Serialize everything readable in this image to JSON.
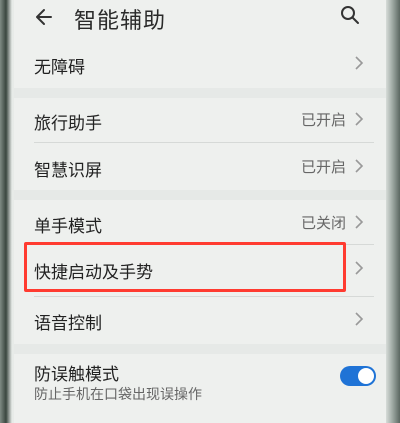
{
  "header": {
    "title": "智能辅助"
  },
  "items": [
    {
      "label": "无障碍",
      "status": ""
    },
    {
      "label": "旅行助手",
      "status": "已开启"
    },
    {
      "label": "智慧识屏",
      "status": "已开启"
    },
    {
      "label": "单手模式",
      "status": "已关闭"
    },
    {
      "label": "快捷启动及手势",
      "status": ""
    },
    {
      "label": "语音控制",
      "status": ""
    }
  ],
  "toggle_item": {
    "label": "防误触模式",
    "sublabel": "防止手机在口袋出现误操作",
    "enabled": true
  },
  "colors": {
    "accent": "#1f73d6",
    "highlight_box": "#ff3b30"
  }
}
